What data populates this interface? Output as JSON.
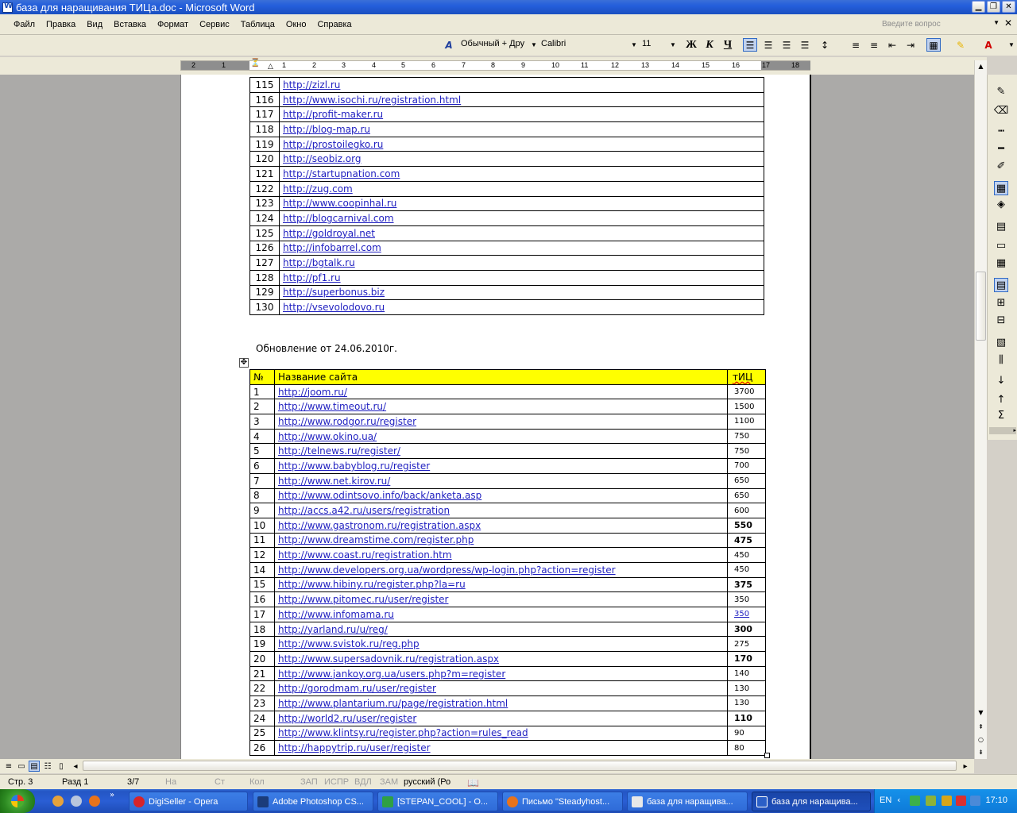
{
  "window": {
    "title": "база для наращивания ТИЦа.doc - Microsoft Word"
  },
  "menu": {
    "items": [
      "Файл",
      "Правка",
      "Вид",
      "Вставка",
      "Формат",
      "Сервис",
      "Таблица",
      "Окно",
      "Справка"
    ],
    "ask_placeholder": "Введите вопрос"
  },
  "toolbar": {
    "style_value": "Обычный + Дру",
    "font_value": "Calibri",
    "size_value": "11",
    "bold_label": "Ж",
    "italic_label": "К",
    "underline_label": "Ч"
  },
  "ruler": {
    "labels": [
      "2",
      "1",
      "",
      "1",
      "2",
      "3",
      "4",
      "5",
      "6",
      "7",
      "8",
      "9",
      "10",
      "11",
      "12",
      "13",
      "14",
      "15",
      "16",
      "17",
      "18"
    ]
  },
  "table1": {
    "rows": [
      {
        "n": "115",
        "url": "http://zizl.ru"
      },
      {
        "n": "116",
        "url": "http://www.isochi.ru/registration.html"
      },
      {
        "n": "117",
        "url": "http://profit-maker.ru"
      },
      {
        "n": "118",
        "url": "http://blog-map.ru"
      },
      {
        "n": "119",
        "url": "http://prostoilegko.ru"
      },
      {
        "n": "120",
        "url": "http://seobiz.org"
      },
      {
        "n": "121",
        "url": "http://startupnation.com"
      },
      {
        "n": "122",
        "url": "http://zug.com"
      },
      {
        "n": "123",
        "url": "http://www.coopinhal.ru"
      },
      {
        "n": "124",
        "url": "http://blogcarnival.com"
      },
      {
        "n": "125",
        "url": "http://goldroyal.net"
      },
      {
        "n": "126",
        "url": "http://infobarrel.com"
      },
      {
        "n": "127",
        "url": "http://bgtalk.ru"
      },
      {
        "n": "128",
        "url": "http://pf1.ru"
      },
      {
        "n": "129",
        "url": "http://superbonus.biz"
      },
      {
        "n": "130",
        "url": "http://vsevolodovo.ru"
      }
    ]
  },
  "update_text": "Обновление от 24.06.2010г.",
  "table2": {
    "headers": {
      "num": "№",
      "name": "Название сайта",
      "tic": "тИЦ"
    },
    "rows": [
      {
        "n": "1",
        "url": "http://joom.ru/",
        "tic": "3700"
      },
      {
        "n": "2",
        "url": "http://www.timeout.ru/",
        "tic": "1500"
      },
      {
        "n": "3",
        "url": "http://www.rodgor.ru/register",
        "tic": "1100"
      },
      {
        "n": "4",
        "url": "http://www.okino.ua/",
        "tic": "750"
      },
      {
        "n": "5",
        "url": "http://telnews.ru/register/",
        "tic": "750"
      },
      {
        "n": "6",
        "url": "http://www.babyblog.ru/register",
        "tic": "700"
      },
      {
        "n": "7",
        "url": "http://www.net.kirov.ru/",
        "tic": "650"
      },
      {
        "n": "8",
        "url": "http://www.odintsovo.info/back/anketa.asp",
        "tic": "650"
      },
      {
        "n": "9",
        "url": "http://accs.a42.ru/users/registration",
        "tic": "600"
      },
      {
        "n": "10",
        "url": "http://www.gastronom.ru/registration.aspx",
        "tic": "550"
      },
      {
        "n": "11",
        "url": "http://www.dreamstime.com/register.php",
        "tic": "475"
      },
      {
        "n": "12",
        "url": "http://www.coast.ru/registration.htm",
        "tic": "450"
      },
      {
        "n": "14",
        "url": "http://www.developers.org.ua/wordpress/wp-login.php?action=register",
        "tic": "450"
      },
      {
        "n": "15",
        "url": "http://www.hibiny.ru/register.php?la=ru",
        "tic": "375"
      },
      {
        "n": "16",
        "url": "http://www.pitomec.ru/user/register",
        "tic": "350"
      },
      {
        "n": "17",
        "url": "http://www.infomama.ru",
        "tic": "350"
      },
      {
        "n": "18",
        "url": "http://yarland.ru/u/reg/",
        "tic": "300"
      },
      {
        "n": "19",
        "url": "http://www.svistok.ru/reg.php",
        "tic": "275"
      },
      {
        "n": "20",
        "url": "http://www.supersadovnik.ru/registration.aspx",
        "tic": "170"
      },
      {
        "n": "21",
        "url": "http://www.jankoy.org.ua/users.php?m=register",
        "tic": "140"
      },
      {
        "n": "22",
        "url": "http://gorodmam.ru/user/register",
        "tic": "130"
      },
      {
        "n": "23",
        "url": "http://www.plantarium.ru/page/registration.html",
        "tic": "130"
      },
      {
        "n": "24",
        "url": "http://world2.ru/user/register",
        "tic": "110"
      },
      {
        "n": "25",
        "url": "http://www.klintsy.ru/register.php?action=rules_read",
        "tic": "90"
      },
      {
        "n": "26",
        "url": "http://happytrip.ru/user/register",
        "tic": "80"
      }
    ]
  },
  "status": {
    "page": "Стр. 3",
    "section": "Разд 1",
    "pages": "3/7",
    "at": "На",
    "line": "Ст",
    "col": "Кол",
    "rec": "ЗАП",
    "trk": "ИСПР",
    "ext": "ВДЛ",
    "ovr": "ЗАМ",
    "lang": "русский (Ро"
  },
  "taskbar": {
    "tasks": [
      "DigiSeller - Opera",
      "Adobe Photoshop CS...",
      "[STEPAN_COOL] - O...",
      "Письмо \"Steadyhost...",
      "база для наращива...",
      "база для наращива..."
    ],
    "lang": "EN",
    "clock": "17:10"
  },
  "colors": {
    "title_bar": "#245edb",
    "link": "#1f1fc0",
    "header_fill": "#ffff00",
    "taskbar": "#2456c4"
  }
}
